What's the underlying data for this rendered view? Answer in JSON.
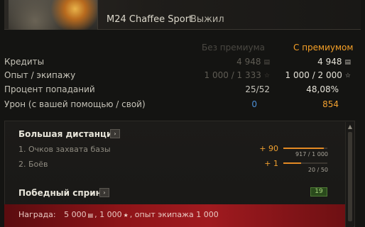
{
  "vehicle": {
    "name": "M24 Chaffee Sport",
    "status": "Выжил"
  },
  "columns": {
    "basic": "Без премиума",
    "premium": "С премиумом"
  },
  "stats": {
    "credits": {
      "label": "Кредиты",
      "basic": "4 948",
      "premium": "4 948",
      "icon": "credits-icon"
    },
    "xp": {
      "label": "Опыт / экипажу",
      "basic": "1 000 / 1 333",
      "premium": "1 000 / 2 000",
      "icon": "xp-star-icon"
    },
    "hit_rate": {
      "label": "Процент попаданий",
      "basic": "25/52",
      "premium": "48,08%"
    },
    "damage": {
      "label": "Урон (с вашей помощью / свой)",
      "basic": "0",
      "premium": "854"
    }
  },
  "quests": [
    {
      "title": "Большая дистанция",
      "conditions": [
        {
          "label": "1. Очков захвата базы",
          "gain": "+ 90",
          "progress_text": "917 / 1 000",
          "progress": 0.917
        },
        {
          "label": "2. Боёв",
          "gain": "+ 1",
          "progress_text": "20 / 50",
          "progress": 0.4
        }
      ]
    },
    {
      "title": "Победный спринт",
      "badge": "19"
    }
  ],
  "reward": {
    "prefix": "Награда:",
    "credits": "5 000",
    "xp": ", 1 000",
    "crew": ", опыт экипажа 1 000"
  },
  "icons": {
    "info": "chevron-right-icon",
    "scroll_up": "arrow-up-icon",
    "credits": "credits-icon",
    "star": "star-icon"
  },
  "colors": {
    "premium_accent": "#f5a027",
    "damage_blue": "#4d8ed4",
    "reward_red": "#a01a1f",
    "badge_green": "#a8d27b"
  }
}
